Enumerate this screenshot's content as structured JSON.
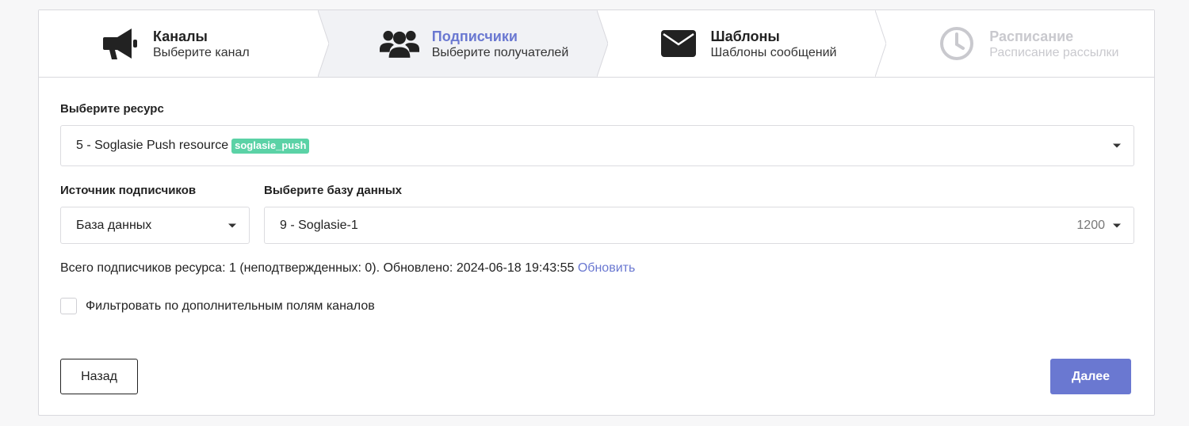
{
  "steps": [
    {
      "title": "Каналы",
      "desc": "Выберите канал",
      "icon": "megaphone-icon",
      "state": "done"
    },
    {
      "title": "Подписчики",
      "desc": "Выберите получателей",
      "icon": "users-icon",
      "state": "active"
    },
    {
      "title": "Шаблоны",
      "desc": "Шаблоны сообщений",
      "icon": "envelope-icon",
      "state": "done"
    },
    {
      "title": "Расписание",
      "desc": "Расписание рассылки",
      "icon": "clock-icon",
      "state": "disabled"
    }
  ],
  "resource": {
    "label": "Выберите ресурс",
    "value": "5 - Soglasie Push resource",
    "tag": "soglasie_push"
  },
  "source": {
    "label": "Источник подписчиков",
    "value": "База данных"
  },
  "database": {
    "label": "Выберите базу данных",
    "value": "9 - Soglasie-1",
    "count": "1200"
  },
  "info": {
    "text": "Всего подписчиков ресурса: 1 (неподтвержденных: 0). Обновлено: 2024-06-18 19:43:55",
    "refresh_link": "Обновить"
  },
  "filter": {
    "label": "Фильтровать по дополнительным полям каналов",
    "checked": false
  },
  "buttons": {
    "back": "Назад",
    "next": "Далее"
  },
  "colors": {
    "accent": "#6a78d1",
    "tag": "#5bd2a6",
    "disabled": "#c9c9ce"
  }
}
